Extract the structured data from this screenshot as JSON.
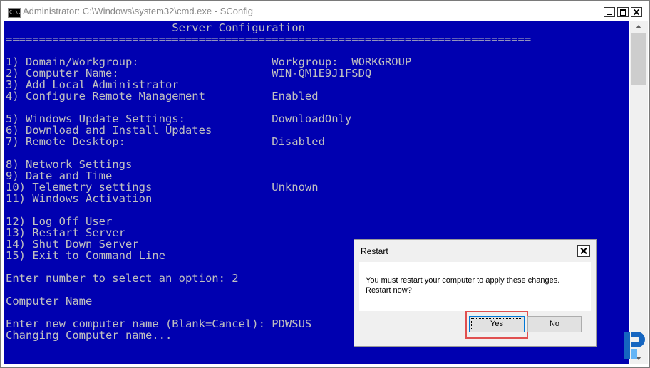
{
  "window": {
    "title": "Administrator: C:\\Windows\\system32\\cmd.exe - SConfig",
    "icon_label": "C:\\."
  },
  "console": {
    "lines": [
      "                         Server Configuration",
      "===============================================================================",
      "",
      "1) Domain/Workgroup:                    Workgroup:  WORKGROUP",
      "2) Computer Name:                       WIN-QM1E9J1FSDQ",
      "3) Add Local Administrator",
      "4) Configure Remote Management          Enabled",
      "",
      "5) Windows Update Settings:             DownloadOnly",
      "6) Download and Install Updates",
      "7) Remote Desktop:                      Disabled",
      "",
      "8) Network Settings",
      "9) Date and Time",
      "10) Telemetry settings                  Unknown",
      "11) Windows Activation",
      "",
      "12) Log Off User",
      "13) Restart Server",
      "14) Shut Down Server",
      "15) Exit to Command Line",
      "",
      "Enter number to select an option: 2",
      "",
      "Computer Name",
      "",
      "Enter new computer name (Blank=Cancel): PDWSUS",
      "Changing Computer name..."
    ]
  },
  "dialog": {
    "title": "Restart",
    "message_line1": "You must restart your computer to apply these changes.",
    "message_line2": "Restart now?",
    "yes_label": "Yes",
    "no_label": "No"
  },
  "colors": {
    "console_bg": "#0000b0",
    "console_text": "#c0c0c0",
    "highlight": "#e05050",
    "logo": "#1565c0"
  }
}
